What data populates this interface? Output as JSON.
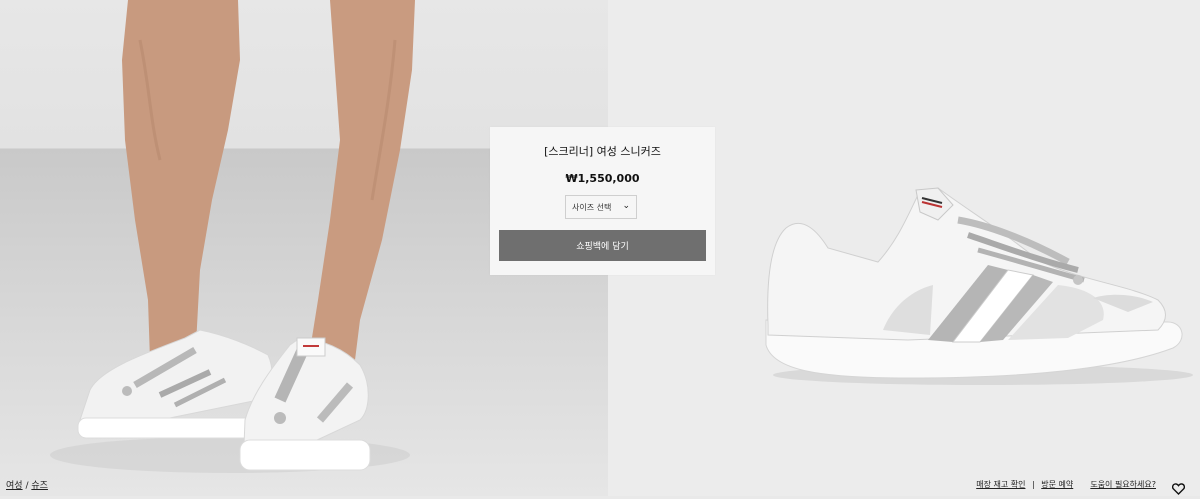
{
  "product": {
    "title": "[스크리너] 여성 스니커즈",
    "price": "₩1,550,000",
    "size_select_label": "사이즈 선택",
    "add_to_bag_label": "쇼핑백에 담기"
  },
  "breadcrumb": {
    "women": "여성",
    "separator": "/",
    "shoes": "슈즈"
  },
  "footer": {
    "stock_check": "매장 재고 확인",
    "visit_booking": "방문 예약",
    "help": "도움이 필요하세요?"
  },
  "icons": {
    "size_dropdown": "chevron-down-icon",
    "wishlist": "heart-icon"
  }
}
